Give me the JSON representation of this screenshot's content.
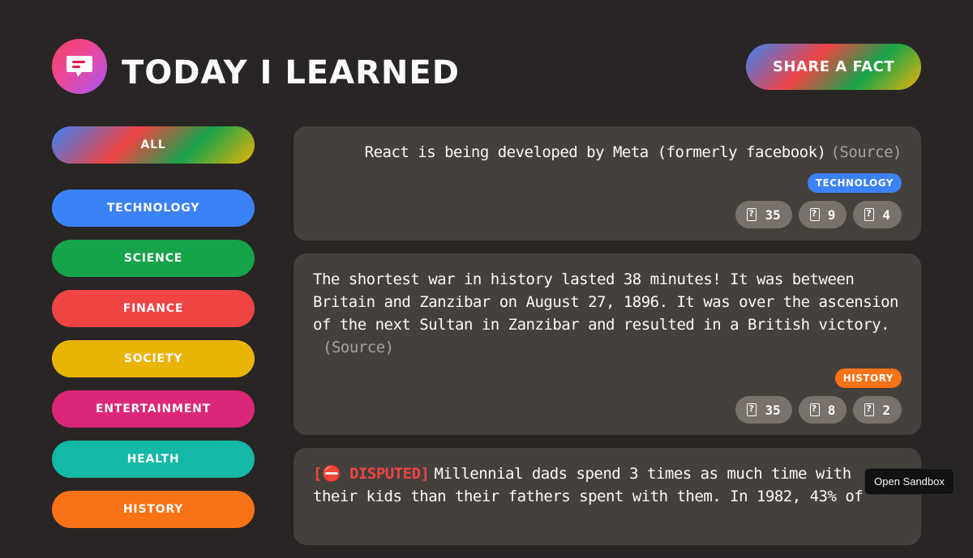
{
  "header": {
    "title": "Today I Learned",
    "share_label": "Share a fact",
    "logo_icon": "speech-bubble-icon"
  },
  "sidebar": {
    "all_label": "All",
    "categories": [
      {
        "label": "Technology",
        "color": "#3b82f6"
      },
      {
        "label": "Science",
        "color": "#16a34a"
      },
      {
        "label": "Finance",
        "color": "#ef4444"
      },
      {
        "label": "Society",
        "color": "#eab308"
      },
      {
        "label": "Entertainment",
        "color": "#db2777"
      },
      {
        "label": "Health",
        "color": "#14b8a6"
      },
      {
        "label": "History",
        "color": "#f97316"
      }
    ]
  },
  "facts": [
    {
      "text": "React is being developed by Meta (formerly facebook)",
      "source_label": "(Source)",
      "tag": "Technology",
      "tag_color": "#3b82f6",
      "votes": {
        "interesting": "35",
        "mindblowing": "9",
        "false": "4"
      }
    },
    {
      "text": "The shortest war in history lasted 38 minutes! It was between Britain and Zanzibar on August 27, 1896. It was over the ascension of the next Sultan in Zanzibar and resulted in a British victory.",
      "source_label": "(Source)",
      "tag": "History",
      "tag_color": "#f97316",
      "votes": {
        "interesting": "35",
        "mindblowing": "8",
        "false": "2"
      }
    },
    {
      "disputed_label": "[⛔️ DISPUTED]",
      "text": "Millennial dads spend 3 times as much time with their kids than their fathers spent with them. In 1982, 43% of"
    }
  ],
  "sandbox_label": "Open Sandbox"
}
